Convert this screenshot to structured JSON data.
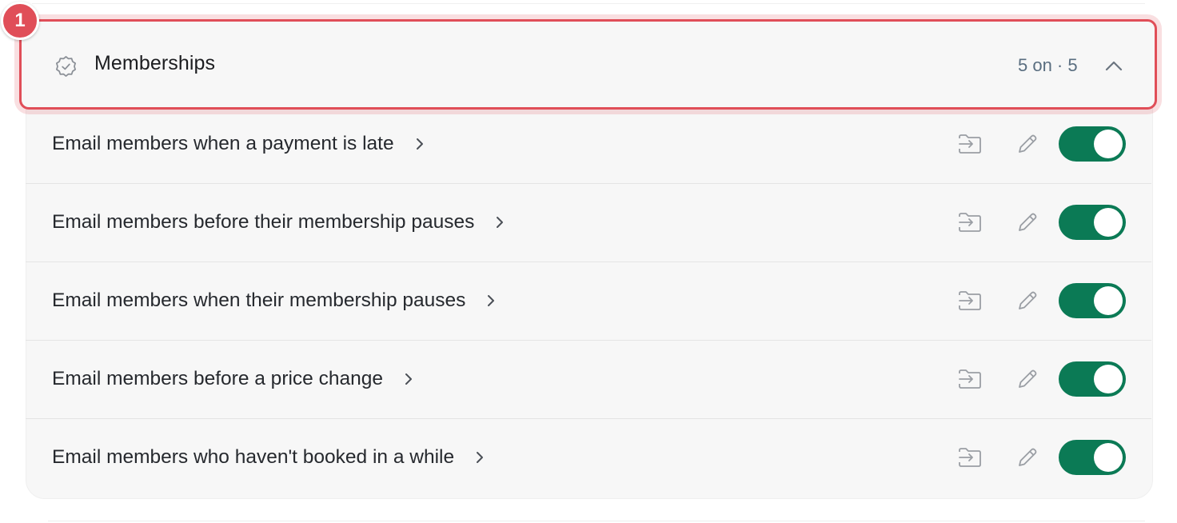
{
  "annotation": {
    "badge_number": "1",
    "color": "#e04e58"
  },
  "section": {
    "title": "Memberships",
    "count_text": "5 on · 5",
    "icon": "badge-check-icon",
    "expanded": true
  },
  "rows": [
    {
      "label": "Email members when a payment is late",
      "enabled": true
    },
    {
      "label": "Email members before their membership pauses",
      "enabled": true
    },
    {
      "label": "Email members when their membership pauses",
      "enabled": true
    },
    {
      "label": "Email members before a price change",
      "enabled": true
    },
    {
      "label": "Email members who haven't booked in a while",
      "enabled": true
    }
  ],
  "row_icons": {
    "move": "move-to-folder-icon",
    "edit": "pencil-icon",
    "open": "chevron-right-icon"
  },
  "colors": {
    "toggle_on": "#0b7a55",
    "accent_outline": "#e04e58",
    "count_text": "#5a6e80"
  }
}
